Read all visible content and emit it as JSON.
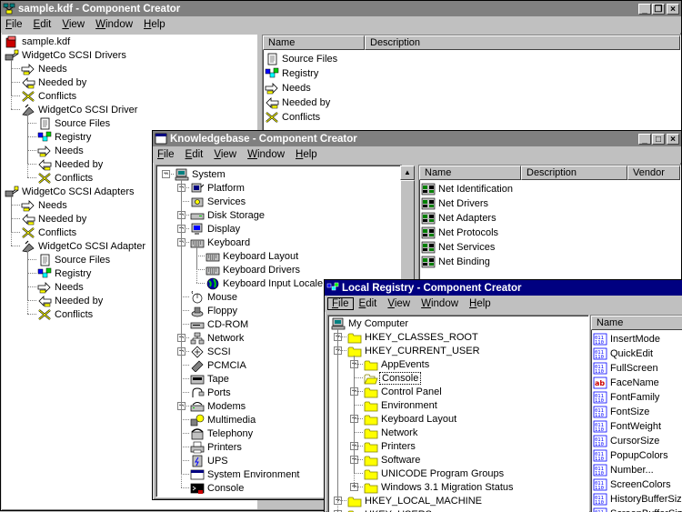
{
  "windows": {
    "main": {
      "title": "sample.kdf - Component Creator",
      "menu": [
        "File",
        "Edit",
        "View",
        "Window",
        "Help"
      ],
      "tree": [
        {
          "label": "sample.kdf",
          "icon": "kdf-file-icon",
          "level": 0
        },
        {
          "label": "WidgetCo SCSI Drivers",
          "icon": "drivers-icon",
          "level": 0
        },
        {
          "label": "Needs",
          "icon": "needs-icon",
          "level": 1
        },
        {
          "label": "Needed by",
          "icon": "needed-by-icon",
          "level": 1
        },
        {
          "label": "Conflicts",
          "icon": "conflicts-icon",
          "level": 1
        },
        {
          "label": "WidgetCo SCSI Driver",
          "icon": "driver-icon",
          "level": 1
        },
        {
          "label": "Source Files",
          "icon": "source-files-icon",
          "level": 2
        },
        {
          "label": "Registry",
          "icon": "registry-icon",
          "level": 2
        },
        {
          "label": "Needs",
          "icon": "needs-icon",
          "level": 2
        },
        {
          "label": "Needed by",
          "icon": "needed-by-icon",
          "level": 2
        },
        {
          "label": "Conflicts",
          "icon": "conflicts-icon",
          "level": 2
        },
        {
          "label": "WidgetCo SCSI Adapters",
          "icon": "drivers-icon",
          "level": 0
        },
        {
          "label": "Needs",
          "icon": "needs-icon",
          "level": 1
        },
        {
          "label": "Needed by",
          "icon": "needed-by-icon",
          "level": 1
        },
        {
          "label": "Conflicts",
          "icon": "conflicts-icon",
          "level": 1
        },
        {
          "label": "WidgetCo SCSI Adapter",
          "icon": "driver-icon",
          "level": 1
        },
        {
          "label": "Source Files",
          "icon": "source-files-icon",
          "level": 2
        },
        {
          "label": "Registry",
          "icon": "registry-icon",
          "level": 2
        },
        {
          "label": "Needs",
          "icon": "needs-icon",
          "level": 2
        },
        {
          "label": "Needed by",
          "icon": "needed-by-icon",
          "level": 2
        },
        {
          "label": "Conflicts",
          "icon": "conflicts-icon",
          "level": 2
        }
      ],
      "list_headers": [
        "Name",
        "Description"
      ],
      "list": [
        {
          "label": "Source Files",
          "icon": "source-files-icon"
        },
        {
          "label": "Registry",
          "icon": "registry-icon"
        },
        {
          "label": "Needs",
          "icon": "needs-icon"
        },
        {
          "label": "Needed by",
          "icon": "needed-by-icon"
        },
        {
          "label": "Conflicts",
          "icon": "conflicts-icon"
        }
      ]
    },
    "kb": {
      "title": "Knowledgebase - Component Creator",
      "menu": [
        "File",
        "Edit",
        "View",
        "Window",
        "Help"
      ],
      "tree": [
        {
          "label": "System",
          "icon": "computer-icon",
          "level": 0,
          "expander": "-"
        },
        {
          "label": "Platform",
          "icon": "platform-icon",
          "level": 1,
          "expander": "+"
        },
        {
          "label": "Services",
          "icon": "services-icon",
          "level": 1,
          "expander": ""
        },
        {
          "label": "Disk Storage",
          "icon": "disk-icon",
          "level": 1,
          "expander": "+"
        },
        {
          "label": "Display",
          "icon": "display-icon",
          "level": 1,
          "expander": "+"
        },
        {
          "label": "Keyboard",
          "icon": "keyboard-icon",
          "level": 1,
          "expander": "-"
        },
        {
          "label": "Keyboard Layout",
          "icon": "keyboard-icon",
          "level": 2,
          "expander": ""
        },
        {
          "label": "Keyboard Drivers",
          "icon": "keyboard-icon",
          "level": 2,
          "expander": ""
        },
        {
          "label": "Keyboard Input Locale",
          "icon": "globe-icon",
          "level": 2,
          "expander": ""
        },
        {
          "label": "Mouse",
          "icon": "mouse-icon",
          "level": 1,
          "expander": ""
        },
        {
          "label": "Floppy",
          "icon": "floppy-icon",
          "level": 1,
          "expander": ""
        },
        {
          "label": "CD-ROM",
          "icon": "cdrom-icon",
          "level": 1,
          "expander": ""
        },
        {
          "label": "Network",
          "icon": "network-icon",
          "level": 1,
          "expander": "+"
        },
        {
          "label": "SCSI",
          "icon": "scsi-icon",
          "level": 1,
          "expander": "+"
        },
        {
          "label": "PCMCIA",
          "icon": "pcmcia-icon",
          "level": 1,
          "expander": ""
        },
        {
          "label": "Tape",
          "icon": "tape-icon",
          "level": 1,
          "expander": ""
        },
        {
          "label": "Ports",
          "icon": "ports-icon",
          "level": 1,
          "expander": ""
        },
        {
          "label": "Modems",
          "icon": "modem-icon",
          "level": 1,
          "expander": "+"
        },
        {
          "label": "Multimedia",
          "icon": "multimedia-icon",
          "level": 1,
          "expander": ""
        },
        {
          "label": "Telephony",
          "icon": "telephony-icon",
          "level": 1,
          "expander": ""
        },
        {
          "label": "Printers",
          "icon": "printer-icon",
          "level": 1,
          "expander": ""
        },
        {
          "label": "UPS",
          "icon": "ups-icon",
          "level": 1,
          "expander": ""
        },
        {
          "label": "System Environment",
          "icon": "environment-icon",
          "level": 1,
          "expander": ""
        },
        {
          "label": "Console",
          "icon": "console-icon",
          "level": 1,
          "expander": ""
        }
      ],
      "list_headers": [
        "Name",
        "Description",
        "Vendor"
      ],
      "list": [
        {
          "label": "Net Identification",
          "icon": "net-icon"
        },
        {
          "label": "Net Drivers",
          "icon": "net-icon"
        },
        {
          "label": "Net Adapters",
          "icon": "net-icon"
        },
        {
          "label": "Net Protocols",
          "icon": "net-icon"
        },
        {
          "label": "Net Services",
          "icon": "net-icon"
        },
        {
          "label": "Net Binding",
          "icon": "net-icon"
        }
      ]
    },
    "reg": {
      "title": "Local Registry - Component Creator",
      "menu": [
        "File",
        "Edit",
        "View",
        "Window",
        "Help"
      ],
      "tree": [
        {
          "label": "My Computer",
          "icon": "computer-icon",
          "level": 0,
          "expander": ""
        },
        {
          "label": "HKEY_CLASSES_ROOT",
          "icon": "folder-icon",
          "level": 1,
          "expander": "+"
        },
        {
          "label": "HKEY_CURRENT_USER",
          "icon": "folder-icon",
          "level": 1,
          "expander": "-"
        },
        {
          "label": "AppEvents",
          "icon": "folder-icon",
          "level": 2,
          "expander": "+"
        },
        {
          "label": "Console",
          "icon": "folder-open-icon",
          "level": 2,
          "expander": "",
          "selected": true
        },
        {
          "label": "Control Panel",
          "icon": "folder-icon",
          "level": 2,
          "expander": "+"
        },
        {
          "label": "Environment",
          "icon": "folder-icon",
          "level": 2,
          "expander": ""
        },
        {
          "label": "Keyboard Layout",
          "icon": "folder-icon",
          "level": 2,
          "expander": "+"
        },
        {
          "label": "Network",
          "icon": "folder-icon",
          "level": 2,
          "expander": ""
        },
        {
          "label": "Printers",
          "icon": "folder-icon",
          "level": 2,
          "expander": "+"
        },
        {
          "label": "Software",
          "icon": "folder-icon",
          "level": 2,
          "expander": "+"
        },
        {
          "label": "UNICODE Program Groups",
          "icon": "folder-icon",
          "level": 2,
          "expander": ""
        },
        {
          "label": "Windows 3.1 Migration Status",
          "icon": "folder-icon",
          "level": 2,
          "expander": "+"
        },
        {
          "label": "HKEY_LOCAL_MACHINE",
          "icon": "folder-icon",
          "level": 1,
          "expander": "+"
        },
        {
          "label": "HKEY_USERS",
          "icon": "folder-icon",
          "level": 1,
          "expander": "+"
        }
      ],
      "list_headers": [
        "Name"
      ],
      "list": [
        {
          "label": "InsertMode",
          "icon": "reg-binary-icon"
        },
        {
          "label": "QuickEdit",
          "icon": "reg-binary-icon"
        },
        {
          "label": "FullScreen",
          "icon": "reg-binary-icon"
        },
        {
          "label": "FaceName",
          "icon": "reg-string-icon"
        },
        {
          "label": "FontFamily",
          "icon": "reg-binary-icon"
        },
        {
          "label": "FontSize",
          "icon": "reg-binary-icon"
        },
        {
          "label": "FontWeight",
          "icon": "reg-binary-icon"
        },
        {
          "label": "CursorSize",
          "icon": "reg-binary-icon"
        },
        {
          "label": "PopupColors",
          "icon": "reg-binary-icon"
        },
        {
          "label": "Number...",
          "icon": "reg-binary-icon"
        },
        {
          "label": "ScreenColors",
          "icon": "reg-binary-icon"
        },
        {
          "label": "HistoryBufferSize",
          "icon": "reg-binary-icon"
        },
        {
          "label": "ScreenBufferSize",
          "icon": "reg-binary-icon"
        }
      ]
    }
  },
  "colors": {
    "active_title": "#000080",
    "inactive_title": "#808080",
    "face": "#c0c0c0"
  }
}
